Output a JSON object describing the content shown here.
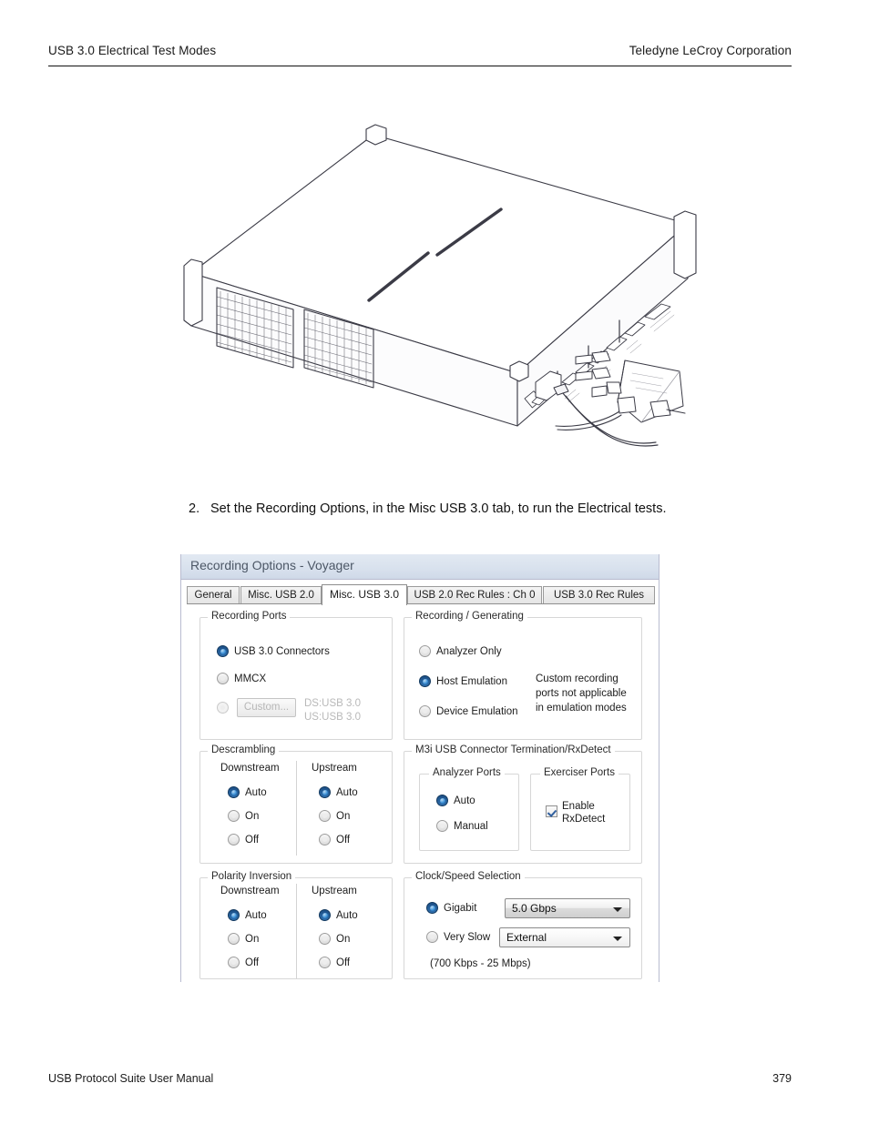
{
  "header": {
    "left": "USB 3.0 Electrical Test Modes",
    "right": "Teledyne LeCroy Corporation"
  },
  "footer": {
    "left": "USB Protocol Suite User Manual",
    "page": "379"
  },
  "figure": {
    "caption_name": "voyager-analyzer-with-mmcx-probe-illustration"
  },
  "step": {
    "number": "2.",
    "text": "Set the Recording Options, in the Misc USB 3.0 tab, to run the Electrical tests."
  },
  "dialog": {
    "title": "Recording Options - Voyager",
    "tabs": [
      {
        "label": "General",
        "active": false
      },
      {
        "label": "Misc. USB 2.0",
        "active": false
      },
      {
        "label": "Misc. USB 3.0",
        "active": true
      },
      {
        "label": "USB 2.0 Rec Rules : Ch 0",
        "active": false
      },
      {
        "label": "USB 3.0 Rec Rules",
        "active": false
      }
    ],
    "recording_ports": {
      "legend": "Recording Ports",
      "options": [
        {
          "label": "USB 3.0 Connectors",
          "selected": true,
          "disabled": false
        },
        {
          "label": "MMCX",
          "selected": false,
          "disabled": false
        },
        {
          "label": "",
          "selected": false,
          "disabled": true
        }
      ],
      "custom_button": "Custom...",
      "custom_info_line1": "DS:USB 3.0",
      "custom_info_line2": "US:USB 3.0"
    },
    "recording_generating": {
      "legend": "Recording / Generating",
      "options": [
        {
          "label": "Analyzer Only",
          "selected": false
        },
        {
          "label": "Host Emulation",
          "selected": true
        },
        {
          "label": "Device Emulation",
          "selected": false
        }
      ],
      "note_line1": "Custom recording",
      "note_line2": "ports not applicable",
      "note_line3": "in emulation modes"
    },
    "descrambling": {
      "legend": "Descrambling",
      "downstream_label": "Downstream",
      "upstream_label": "Upstream",
      "downstream": [
        {
          "label": "Auto",
          "selected": true
        },
        {
          "label": "On",
          "selected": false
        },
        {
          "label": "Off",
          "selected": false
        }
      ],
      "upstream": [
        {
          "label": "Auto",
          "selected": true
        },
        {
          "label": "On",
          "selected": false
        },
        {
          "label": "Off",
          "selected": false
        }
      ]
    },
    "termination": {
      "legend": "M3i USB Connector Termination/RxDetect",
      "analyzer_ports": {
        "legend": "Analyzer Ports",
        "options": [
          {
            "label": "Auto",
            "selected": true
          },
          {
            "label": "Manual",
            "selected": false
          }
        ]
      },
      "exerciser_ports": {
        "legend": "Exerciser Ports",
        "checkbox_line1": "Enable",
        "checkbox_line2": "RxDetect",
        "checked": true
      }
    },
    "polarity_inversion": {
      "legend": "Polarity Inversion",
      "downstream_label": "Downstream",
      "upstream_label": "Upstream",
      "downstream": [
        {
          "label": "Auto",
          "selected": true
        },
        {
          "label": "On",
          "selected": false
        },
        {
          "label": "Off",
          "selected": false
        }
      ],
      "upstream": [
        {
          "label": "Auto",
          "selected": true
        },
        {
          "label": "On",
          "selected": false
        },
        {
          "label": "Off",
          "selected": false
        }
      ]
    },
    "clock_speed": {
      "legend": "Clock/Speed Selection",
      "gigabit_label": "Gigabit",
      "gigabit_selected": true,
      "gigabit_value": "5.0 Gbps",
      "very_slow_label": "Very Slow",
      "very_slow_selected": false,
      "very_slow_value": "External",
      "range_note": "(700 Kbps - 25 Mbps)"
    }
  }
}
